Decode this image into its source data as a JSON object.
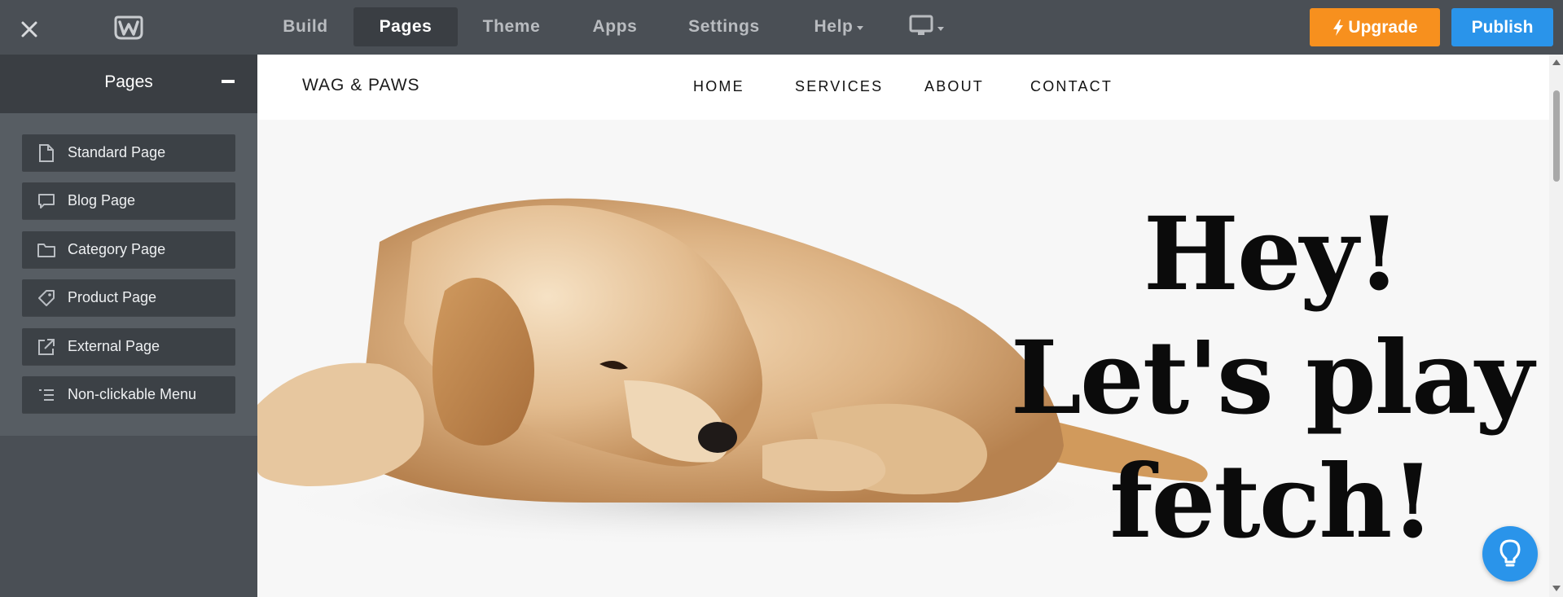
{
  "topbar": {
    "close_icon": "close-icon",
    "logo_icon": "weebly-logo-icon",
    "tabs": [
      {
        "label": "Build"
      },
      {
        "label": "Pages"
      },
      {
        "label": "Theme"
      },
      {
        "label": "Apps"
      },
      {
        "label": "Settings"
      },
      {
        "label": "Help"
      }
    ],
    "active_tab": "Pages",
    "device_icon": "monitor-icon",
    "upgrade_label": "Upgrade",
    "publish_label": "Publish",
    "upgrade_color": "#f7901e",
    "publish_color": "#2a94ea"
  },
  "sidebar": {
    "title": "Pages",
    "page_types": [
      {
        "label": "Standard Page",
        "icon": "document-icon"
      },
      {
        "label": "Blog Page",
        "icon": "comment-icon"
      },
      {
        "label": "Category Page",
        "icon": "folder-icon"
      },
      {
        "label": "Product Page",
        "icon": "tag-icon"
      },
      {
        "label": "External Page",
        "icon": "external-link-icon"
      },
      {
        "label": "Non-clickable Menu",
        "icon": "menu-list-icon"
      }
    ]
  },
  "site": {
    "brand": "WAG & PAWS",
    "nav": [
      "HOME",
      "SERVICES",
      "ABOUT",
      "CONTACT"
    ],
    "hero_lines": [
      "Hey!",
      "Let's play",
      "fetch!"
    ],
    "hero_image": "puppy-lying-down"
  },
  "help_icon": "lightbulb-icon"
}
